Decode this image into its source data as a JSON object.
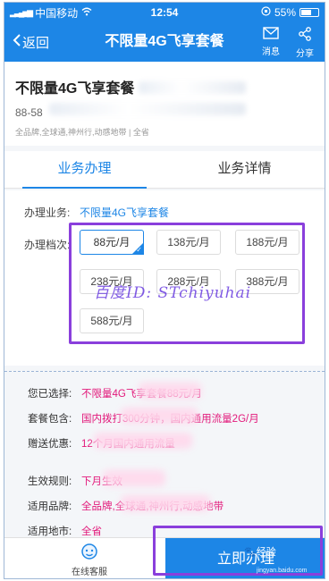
{
  "status_bar": {
    "carrier": "中国移动",
    "time": "12:54",
    "battery": "55%"
  },
  "nav": {
    "back_label": "返回",
    "title": "不限量4G飞享套餐",
    "message_label": "消息",
    "share_label": "分享"
  },
  "product": {
    "name": "不限量4G飞享套餐",
    "price_prefix": "88-58",
    "meta": "全品牌,全球通,神州行,动感地带 | 全省"
  },
  "tabs": [
    {
      "label": "业务办理"
    },
    {
      "label": "业务详情"
    }
  ],
  "form": {
    "business_label": "办理业务:",
    "business_value": "不限量4G飞享套餐",
    "tier_label": "办理档次:",
    "tiers": [
      {
        "label": "88元/月",
        "selected": true
      },
      {
        "label": "138元/月"
      },
      {
        "label": "188元/月"
      },
      {
        "label": "238元/月"
      },
      {
        "label": "288元/月"
      },
      {
        "label": "388元/月"
      },
      {
        "label": "588元/月"
      }
    ]
  },
  "watermark": "百度ID: STchiyuhai",
  "summary": {
    "rows": [
      {
        "label": "您已选择:",
        "value": "不限量4G飞享套餐88元/月"
      },
      {
        "label": "套餐包含:",
        "value": "国内拨打300分钟，国内通用流量2G/月"
      },
      {
        "label": "赠送优惠:",
        "value": "12个月国内通用流量"
      },
      {
        "label": "生效规则:",
        "value": "下月生效"
      },
      {
        "label": "适用品牌:",
        "value": "全品牌,全球通,神州行,动感地带"
      },
      {
        "label": "适用地市:",
        "value": "全省"
      }
    ]
  },
  "bottom": {
    "service_label": "在线客服",
    "apply_label": "立即办理",
    "jingyan_label": "经验",
    "jingyan_url": "jingyan.baidu.com"
  },
  "colors": {
    "primary": "#1d86e6",
    "highlight": "#e2187a",
    "annotation": "#8a3fdc"
  }
}
